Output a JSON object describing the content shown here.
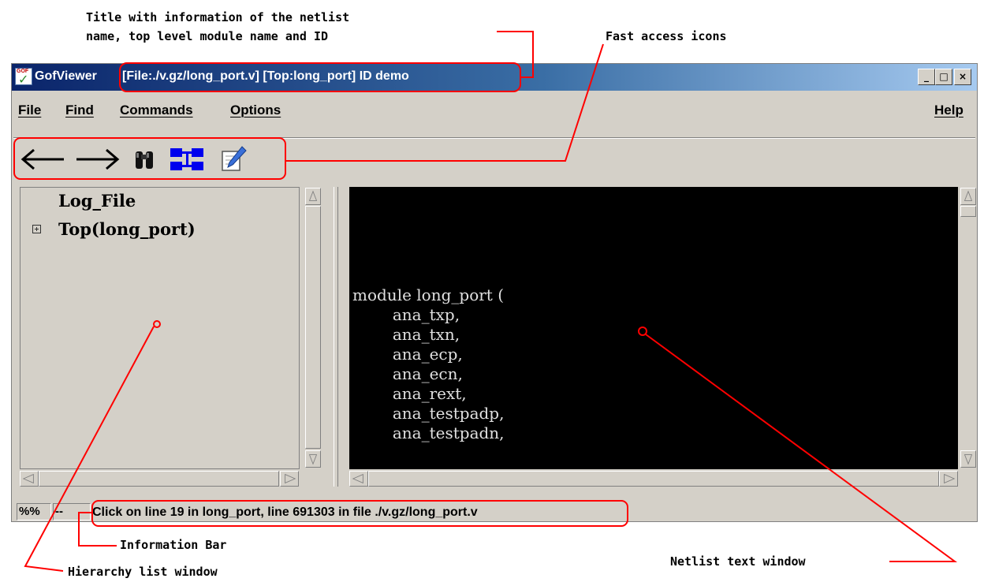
{
  "annotations": {
    "title_note": "Title with information of the netlist\nname, top level module name and ID",
    "fast_access": "Fast access icons",
    "information_bar": "Information Bar",
    "hierarchy_list": "Hierarchy list window",
    "netlist_text": "Netlist text window"
  },
  "window": {
    "app_name": "GofViewer",
    "title_info": "[File:./v.gz/long_port.v] [Top:long_port] ID demo",
    "controls": [
      "_",
      "□",
      "×"
    ]
  },
  "menu": {
    "file": "File",
    "find": "Find",
    "commands": "Commands",
    "options": "Options",
    "help": "Help"
  },
  "toolbar": {
    "icons": [
      "arrow-left-icon",
      "arrow-right-icon",
      "binoculars-icon",
      "schematic-icon",
      "edit-icon"
    ]
  },
  "tree": {
    "items": [
      "Log_File",
      "Top(long_port)"
    ]
  },
  "code": {
    "text": "\nmodule long_port (\n        ana_txp,\n        ana_txn,\n        ana_ecp,\n        ana_ecn,\n        ana_rext,\n        ana_testpadp,\n        ana_testpadn,"
  },
  "status": {
    "percent": "%%",
    "dash": "--",
    "message": "Click on line 19 in long_port, line 691303 in file ./v.gz/long_port.v"
  },
  "colors": {
    "annotation_red": "#ff0000",
    "titlebar_blue": "#0a246a",
    "window_gray": "#d4d0c8",
    "code_background": "#000000",
    "code_text": "#e0e0e0"
  }
}
